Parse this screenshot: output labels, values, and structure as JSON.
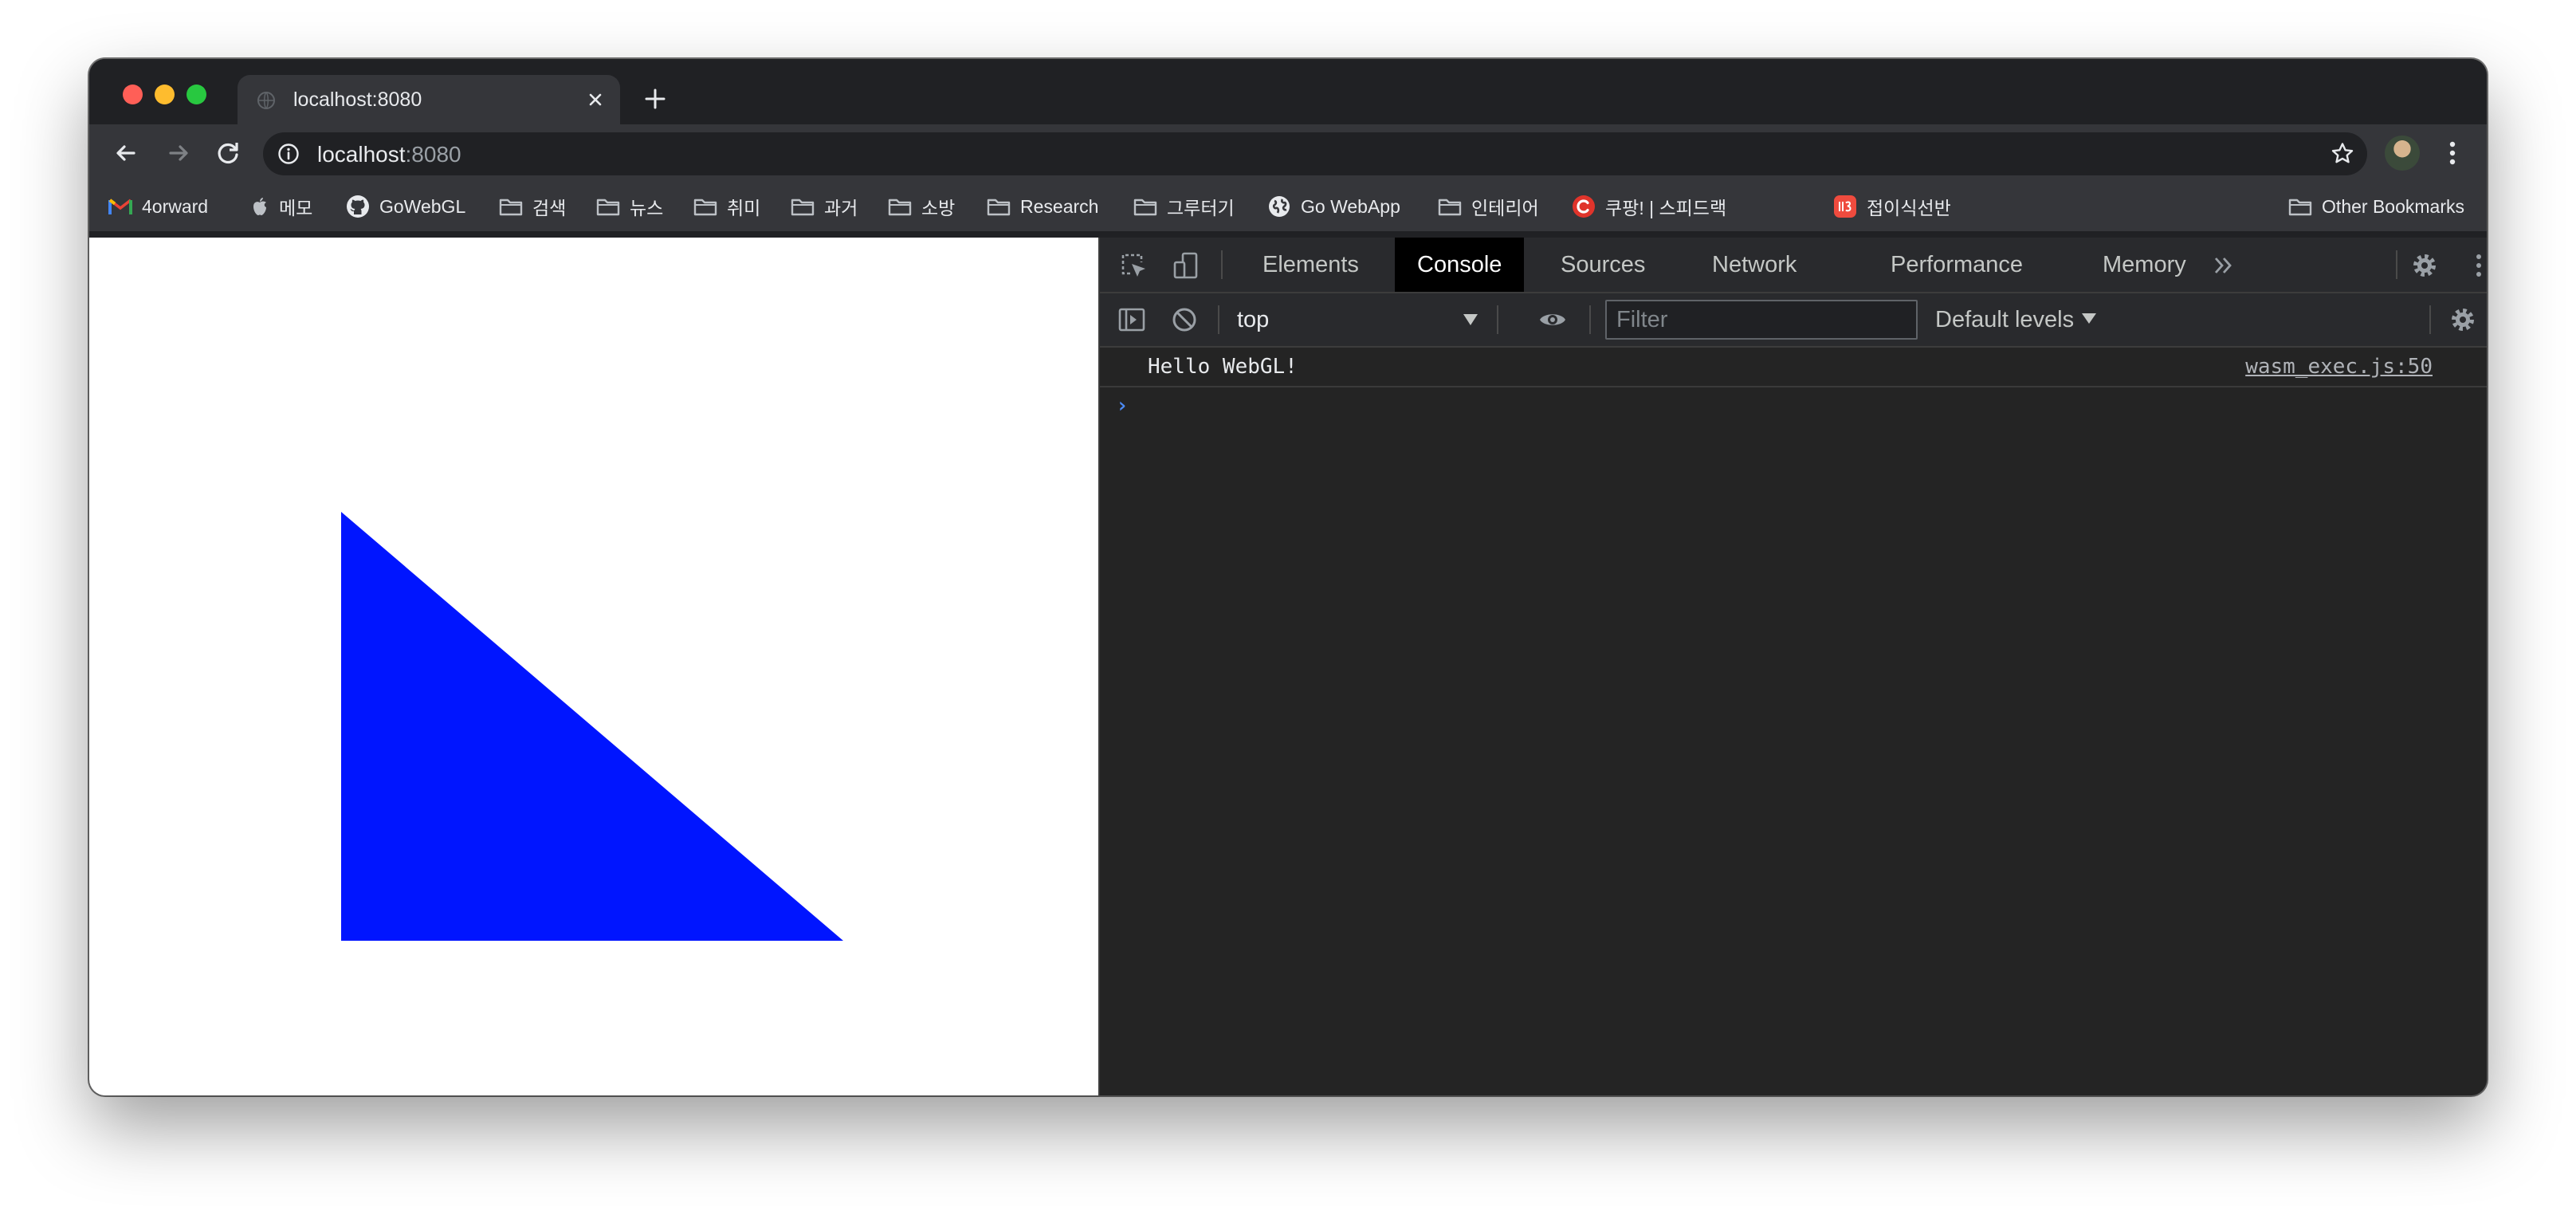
{
  "window": {
    "traffic_lights": [
      "close",
      "minimize",
      "zoom"
    ]
  },
  "tab": {
    "title": "localhost:8080",
    "close_icon": "close-icon"
  },
  "toolbar": {
    "url_host": "localhost",
    "url_port": ":8080",
    "buttons": [
      "back",
      "forward",
      "reload",
      "site-info",
      "bookmark-star",
      "profile",
      "menu"
    ]
  },
  "bookmarks": {
    "items": [
      {
        "label": "4orward",
        "icon": "gmail-icon"
      },
      {
        "label": "메모",
        "icon": "apple-icon"
      },
      {
        "label": "GoWebGL",
        "icon": "github-icon"
      },
      {
        "label": "검색",
        "icon": "folder-icon"
      },
      {
        "label": "뉴스",
        "icon": "folder-icon"
      },
      {
        "label": "취미",
        "icon": "folder-icon"
      },
      {
        "label": "과거",
        "icon": "folder-icon"
      },
      {
        "label": "소방",
        "icon": "folder-icon"
      },
      {
        "label": "Research",
        "icon": "folder-icon"
      },
      {
        "label": "그루터기",
        "icon": "folder-icon"
      },
      {
        "label": "Go WebApp",
        "icon": "globe-icon"
      },
      {
        "label": "인테리어",
        "icon": "folder-icon"
      },
      {
        "label": "쿠팡! | 스피드랙",
        "icon": "coupang-icon"
      },
      {
        "label": "접이식선반",
        "icon": "11st-icon"
      }
    ],
    "other": "Other Bookmarks"
  },
  "page": {
    "triangle_color": "#0015ff",
    "background": "#ffffff"
  },
  "devtools": {
    "tabs": [
      "Elements",
      "Console",
      "Sources",
      "Network",
      "Performance",
      "Memory"
    ],
    "active_tab": "Console",
    "context": "top",
    "filter_placeholder": "Filter",
    "levels": "Default levels",
    "messages": [
      {
        "text": "Hello WebGL!",
        "source": "wasm_exec.js:50"
      }
    ],
    "prompt": "›"
  }
}
